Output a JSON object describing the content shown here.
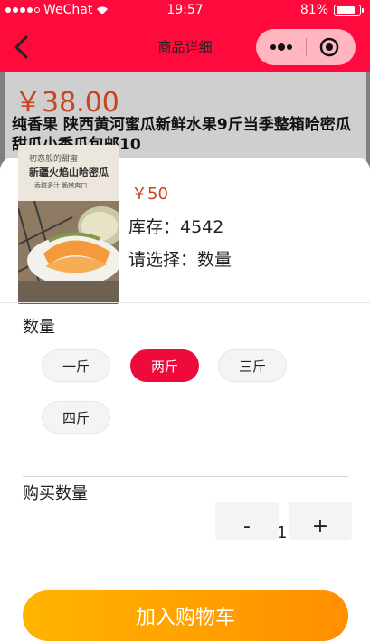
{
  "status_bar": {
    "carrier": "WeChat",
    "time": "19:57",
    "battery": "81%",
    "battery_level": 0.81,
    "signal_bars": 5,
    "signal_filled": 4
  },
  "nav": {
    "title": "商品详细"
  },
  "product": {
    "price": "￥38.00",
    "name": "纯香果 陕西黄河蜜瓜新鲜水果9斤当季整箱哈密瓜甜瓜小香瓜包邮10",
    "image_texts": [
      "初恋般的甜蜜",
      "新疆火焰山哈密瓜",
      "香甜多汁 脆嫩爽口"
    ]
  },
  "sku_sheet": {
    "price": "￥50",
    "stock": "库存：4542",
    "choose": "请选择：数量",
    "spec_title": "数量",
    "options": [
      {
        "label": "一斤",
        "selected": false
      },
      {
        "label": "两斤",
        "selected": true
      },
      {
        "label": "三斤",
        "selected": false
      },
      {
        "label": "四斤",
        "selected": false
      }
    ],
    "quantity_title": "购买数量",
    "minus": "-",
    "quantity": "1",
    "plus": "+",
    "add_to_cart": "加入购物车"
  },
  "colors": {
    "nav_bg": "#ff0a3c",
    "price": "#c6441e",
    "chip_active": "#ee0a3a",
    "button_start": "#ffb400",
    "button_end": "#ff8f00"
  }
}
